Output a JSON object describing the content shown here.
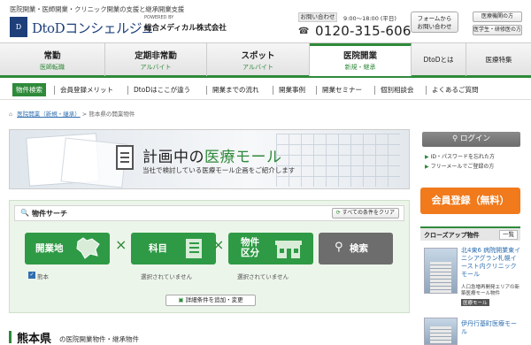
{
  "header": {
    "tagline": "医院開業・医師開業・クリニック開業の支援と継承開業支援",
    "logo_mark": "D",
    "logo_text": "DtoDコンシェルジュ",
    "powered_by": "POWERED BY",
    "company": "総合メディカル株式会社",
    "contact_label": "お問い合わせ",
    "hours": "9:00～18:00 (平日)",
    "tel_icon": "free-dial-icon",
    "tel": "0120-315-606",
    "form_button": [
      "フォームから",
      "お問い合わせ"
    ],
    "hospital_transfer": "医療機関の方",
    "student_link": "医学生・研修医の方"
  },
  "main_nav": [
    {
      "title": "常勤",
      "sub": "医師転職"
    },
    {
      "title": "定期非常勤",
      "sub": "アルバイト"
    },
    {
      "title": "スポット",
      "sub": "アルバイト"
    },
    {
      "title": "医院開業",
      "sub": "新規・継承",
      "active": true
    }
  ],
  "main_nav_small": [
    "DtoDとは",
    "医療特集"
  ],
  "sub_nav": [
    "物件検索",
    "会員登録メリット",
    "DtoDはここが違う",
    "開業までの流れ",
    "開業事例",
    "開業セミナー",
    "個別相談会",
    "よくあるご質問"
  ],
  "breadcrumb": {
    "home_icon": "home-icon",
    "link": "医院開業（新規・継承）",
    "separator": ">",
    "current": "熊本県の開業物件"
  },
  "banner": {
    "title_prefix": "計画中の",
    "title_accent": "医療モール",
    "subtitle": "当社で検討している医療モール企画をご紹介します"
  },
  "sidebar": {
    "login": "ログイン",
    "link_password": "ID・パスワードを忘れた方",
    "link_free": "フリーメールでご登録の方",
    "register": "会員登録（無料）",
    "closeup_label": "クローズアップ物件",
    "closeup_more": "一覧",
    "picks": [
      {
        "title": "北4東6 病院開業東イニシアグラン札幌イースト内クリニックモール",
        "desc": "人口急増再開発エリアの新築医療モール物件",
        "badge": "医療モール"
      },
      {
        "title": "伊丹行基町医療モール",
        "desc": "",
        "badge": ""
      }
    ]
  },
  "search": {
    "label": "物件サーチ",
    "clear": "すべての条件をクリア",
    "tiles": [
      {
        "label": "開業地",
        "note": "熊本",
        "checked": true
      },
      {
        "label": "科目",
        "note": "選択されていません"
      },
      {
        "label": "物件区分",
        "note": "選択されていません"
      }
    ],
    "search_button": "検索",
    "times": "×",
    "add_condition": "詳細条件を追加・変更"
  },
  "bottom": {
    "title": "熊本県",
    "subtitle": "の医院開業物件・継承物件"
  }
}
